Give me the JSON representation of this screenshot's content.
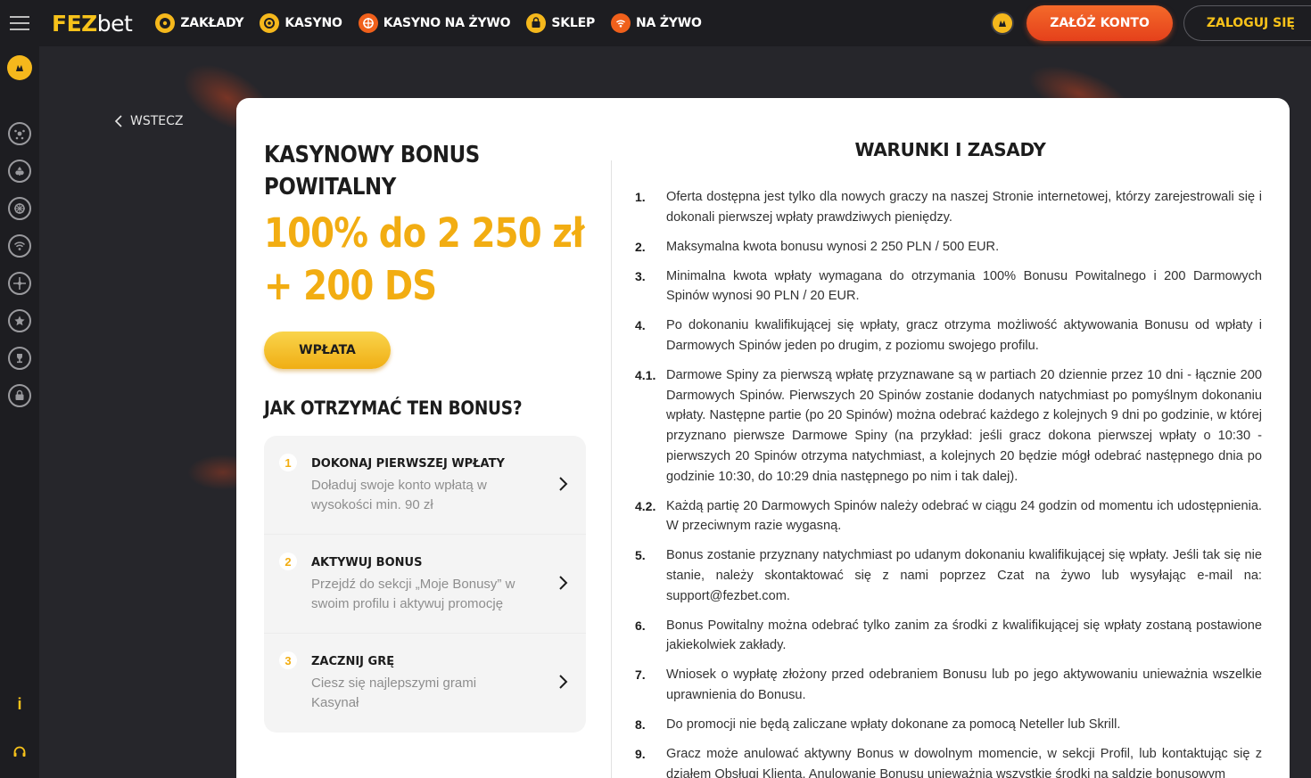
{
  "header": {
    "logo_fez": "FEZ",
    "logo_bet": "bet",
    "nav": [
      {
        "label": "ZAKŁADY",
        "icon": "soccer-ball-icon"
      },
      {
        "label": "KASYNO",
        "icon": "casino-chip-icon"
      },
      {
        "label": "KASYNO NA ŻYWO",
        "icon": "roulette-icon"
      },
      {
        "label": "SKLEP",
        "icon": "shop-bag-icon"
      },
      {
        "label": "NA ŻYWO",
        "icon": "live-signal-icon"
      }
    ],
    "register_label": "ZAŁÓŻ KONTO",
    "login_label": "ZALOGUJ SIĘ"
  },
  "sidebar": {
    "icons": [
      "vip-icon",
      "soccer-ball-icon",
      "casino-chip-icon",
      "roulette-icon",
      "live-signal-icon",
      "wheel-icon",
      "star-icon",
      "trophy-icon",
      "shop-bag-icon",
      "info-icon",
      "support-headset-icon"
    ],
    "info_label": "i"
  },
  "back_label": "WSTECZ",
  "bonus": {
    "title": "KASYNOWY BONUS POWITALNY",
    "amount_line1": "100% do 2 250 zł",
    "amount_line2": "+ 200 DS",
    "deposit_label": "WPŁATA",
    "how_title": "JAK OTRZYMAĆ TEN BONUS?",
    "steps": [
      {
        "num": "1",
        "title": "DOKONAJ PIERWSZEJ WPŁATY",
        "desc": "Doładuj swoje konto wpłatą w wysokości min. 90 zł"
      },
      {
        "num": "2",
        "title": "AKTYWUJ BONUS",
        "desc": "Przejdź do sekcji „Moje Bonusy” w swoim profilu i aktywuj promocję"
      },
      {
        "num": "3",
        "title": "ZACZNIJ GRĘ",
        "desc": "Ciesz się najlepszymi grami Kasynał"
      }
    ]
  },
  "terms": {
    "title": "WARUNKI I ZASADY",
    "items": [
      {
        "num": "1.",
        "text": "Oferta dostępna jest tylko dla nowych graczy na naszej Stronie internetowej, którzy zarejestrowali się i dokonali pierwszej wpłaty prawdziwych pieniędzy."
      },
      {
        "num": "2.",
        "text": "Maksymalna kwota bonusu wynosi 2 250 PLN / 500 EUR."
      },
      {
        "num": "3.",
        "text": "Minimalna kwota wpłaty wymagana do otrzymania 100% Bonusu Powitalnego i 200 Darmowych Spinów wynosi 90 PLN / 20 EUR."
      },
      {
        "num": "4.",
        "text": "Po dokonaniu kwalifikującej się wpłaty, gracz otrzyma możliwość aktywowania Bonusu od wpłaty i Darmowych Spinów jeden po drugim, z poziomu swojego profilu."
      },
      {
        "num": "4.1.",
        "text": "Darmowe Spiny za pierwszą wpłatę przyznawane są w partiach 20 dziennie przez 10 dni - łącznie 200 Darmowych Spinów. Pierwszych 20 Spinów zostanie dodanych natychmiast po pomyślnym dokonaniu wpłaty. Następne partie (po 20 Spinów) można odebrać każdego z kolejnych 9 dni po godzinie, w której przyznano pierwsze Darmowe Spiny (na przykład: jeśli gracz dokona pierwszej wpłaty o 10:30 - pierwszych 20 Spinów otrzyma natychmiast, a kolejnych 20 będzie mógł odebrać następnego dnia po godzinie 10:30, do 10:29 dnia następnego po nim i tak dalej)."
      },
      {
        "num": "4.2.",
        "text": "Każdą partię 20 Darmowych Spinów należy odebrać w ciągu 24 godzin od momentu ich udostępnienia. W przeciwnym razie wygasną."
      },
      {
        "num": "5.",
        "text": "Bonus zostanie przyznany natychmiast po udanym dokonaniu kwalifikującej się wpłaty. Jeśli tak się nie stanie, należy skontaktować się z nami poprzez Czat na żywo lub wysyłając e-mail na: support@fezbet.com."
      },
      {
        "num": "6.",
        "text": "Bonus Powitalny można odebrać tylko zanim za środki z kwalifikującej się wpłaty zostaną postawione jakiekolwiek zakłady."
      },
      {
        "num": "7.",
        "text": "Wniosek o wypłatę złożony przed odebraniem Bonusu lub po jego aktywowaniu unieważnia wszelkie uprawnienia do Bonusu."
      },
      {
        "num": "8.",
        "text": "Do promocji nie będą zaliczane wpłaty dokonane za pomocą Neteller lub Skrill."
      },
      {
        "num": "9.",
        "text": "Gracz może anulować aktywny Bonus w dowolnym momencie, w sekcji Profil, lub kontaktując się z działem Obsługi Klienta. Anulowanie Bonusu unieważnia wszystkie środki na saldzie bonusowym"
      }
    ]
  }
}
